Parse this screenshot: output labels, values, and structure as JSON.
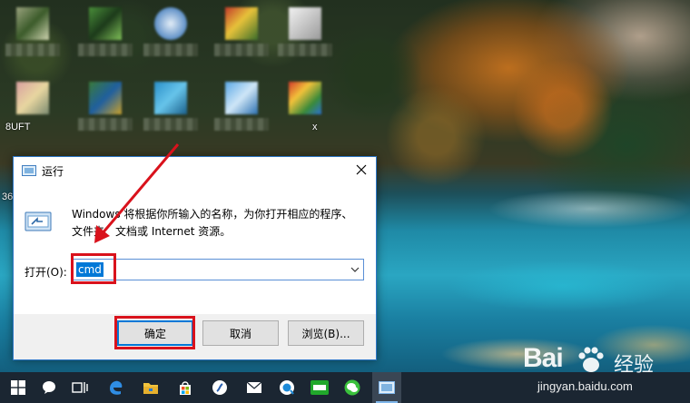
{
  "desktop": {
    "partial_labels": [
      "8UFT",
      "x",
      "36"
    ],
    "icon_count": 10
  },
  "run_dialog": {
    "title": "运行",
    "description_line1": "Windows 将根据你所输入的名称，为你打开相应的程序、",
    "description_line2": "文件夹、文档或 Internet 资源。",
    "open_label": "打开(O):",
    "open_value": "cmd",
    "ok_label": "确定",
    "cancel_label": "取消",
    "browse_label": "浏览(B)...",
    "close_icon": "close-icon",
    "run_icon": "run-icon"
  },
  "annotation": {
    "color": "#d9121c"
  },
  "taskbar": {
    "items": [
      "windows-start-icon",
      "cortana-icon",
      "task-view-icon",
      "edge-icon",
      "file-explorer-icon",
      "store-icon",
      "app-circle-icon",
      "mail-icon",
      "qq-browser-icon",
      "green-app-icon",
      "wechat-icon",
      "run-app-icon"
    ]
  },
  "watermark": {
    "brand": "Bai",
    "brand_suffix": "经验",
    "url": "jingyan.baidu.com"
  },
  "colors": {
    "accent": "#0078d7",
    "highlight": "#d9121c",
    "taskbar": "#1b2632"
  }
}
